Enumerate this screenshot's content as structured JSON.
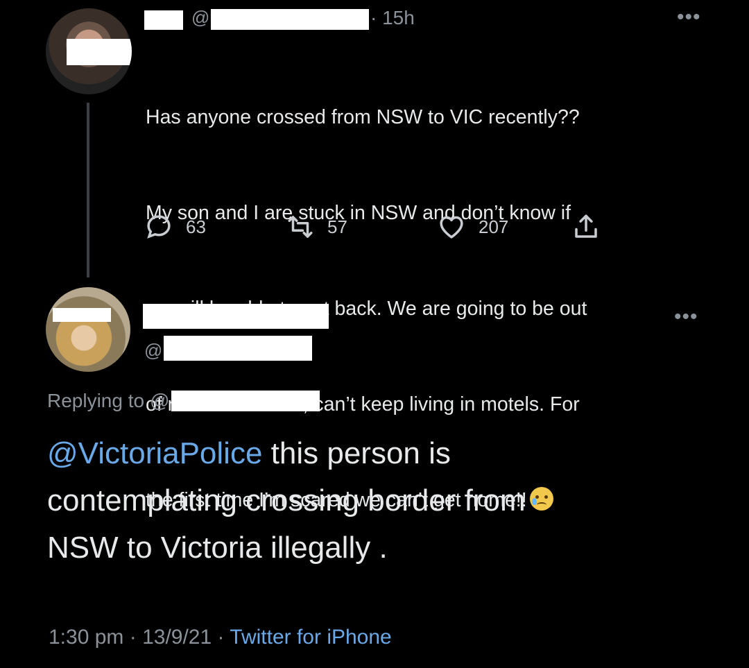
{
  "tweet": {
    "handle_prefix": "@",
    "time_ago": "· 15h",
    "more_label": "•••",
    "text_lines": [
      "Has anyone crossed from NSW to VIC recently??",
      "My son and I are stuck in NSW and don’t know if",
      "we will be able to get back. We are going to be out",
      "of resources soon, can’t keep living in motels. For",
      "the first time I’m scared we can’t get home!!"
    ],
    "emoji": "sad-but-relieved-face",
    "actions": {
      "replies": "63",
      "retweets": "57",
      "likes": "207"
    }
  },
  "reply": {
    "handle_prefix": "@",
    "more_label": "•••",
    "replying_to_label": "Replying to",
    "replying_to_at": "@",
    "mention": "@VictoriaPolice",
    "text_line1_rest": " this person is",
    "text_line2": "contemplating crossing border from",
    "text_line3": "NSW to Victoria illegally .",
    "time": "1:30 pm",
    "sep1": " · ",
    "date": "13/9/21",
    "sep2": " · ",
    "source": "Twitter for iPhone"
  },
  "colors": {
    "background": "#000000",
    "text": "#e7e9ea",
    "muted": "#8b9299",
    "link": "#6aa9e8"
  }
}
